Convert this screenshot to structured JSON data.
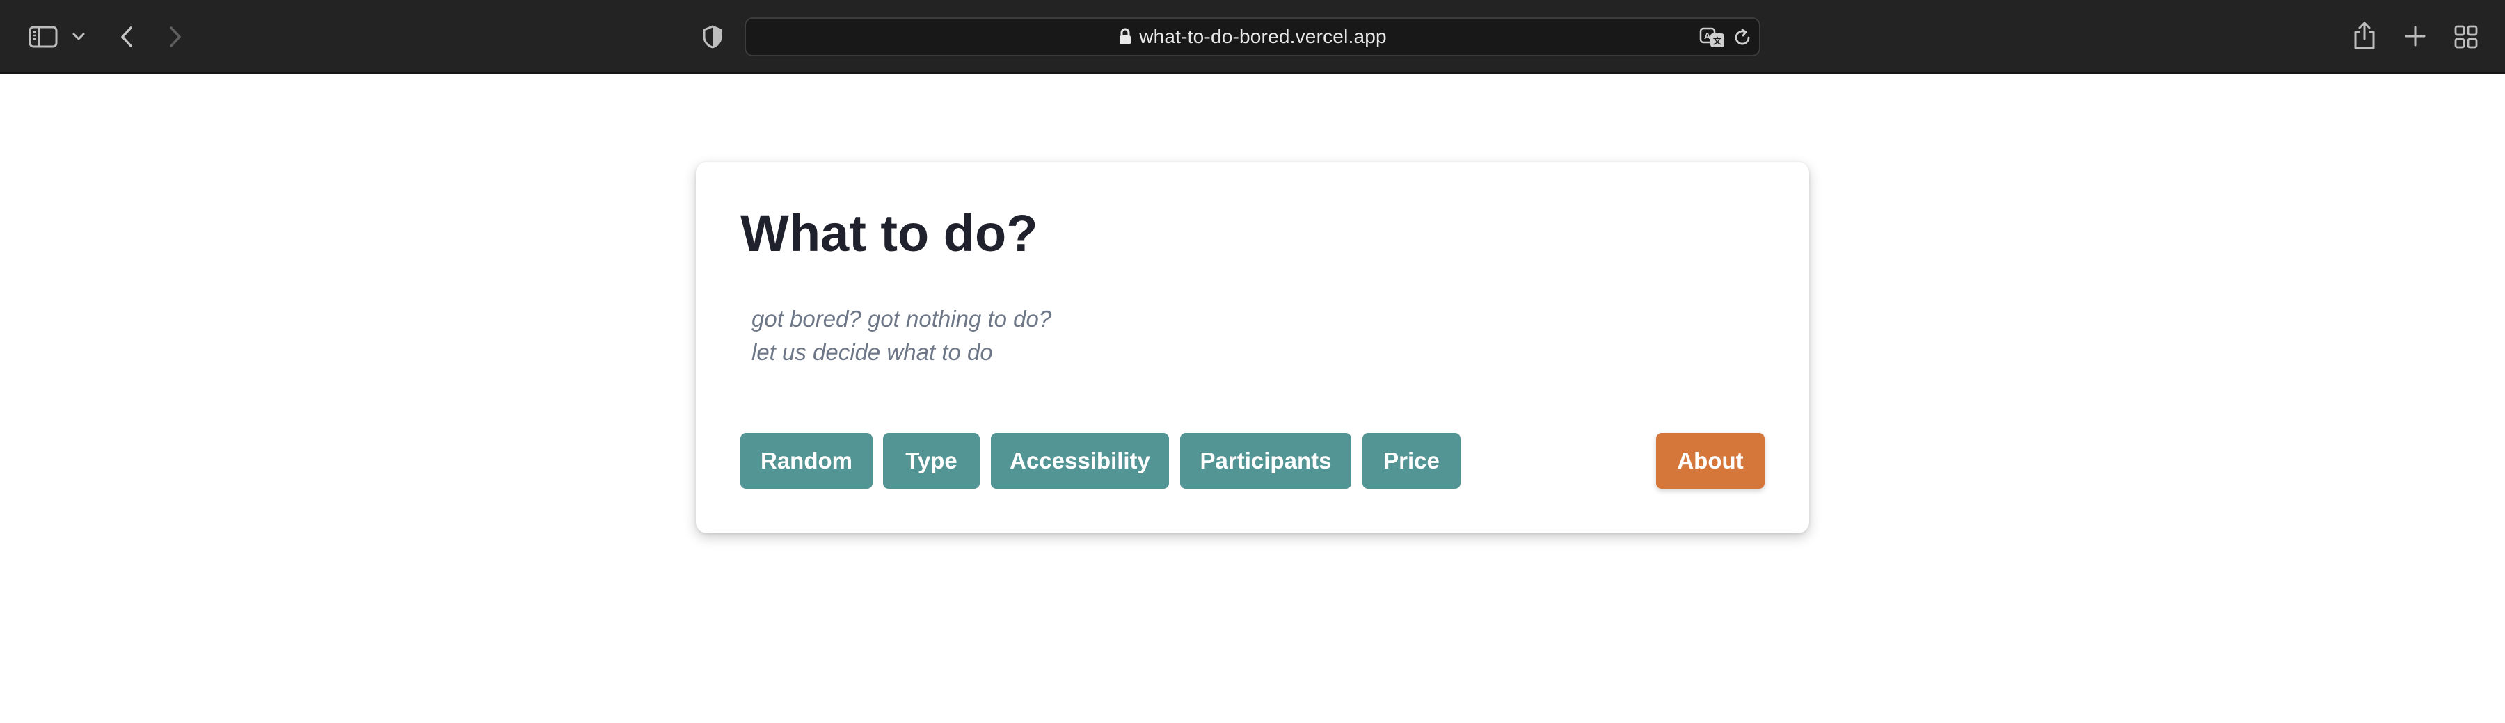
{
  "browser": {
    "url": "what-to-do-bored.vercel.app"
  },
  "app": {
    "title": "What to do?",
    "subtitle_line1": "got bored? got nothing to do?",
    "subtitle_line2": "let us decide what to do",
    "buttons": [
      {
        "label": "Random"
      },
      {
        "label": "Type"
      },
      {
        "label": "Accessibility"
      },
      {
        "label": "Participants"
      },
      {
        "label": "Price"
      }
    ],
    "about_label": "About"
  },
  "colors": {
    "primary_button": "#529594",
    "about_button": "#d5763a",
    "title": "#1f222d",
    "subtitle": "#6e7787",
    "toolbar": "#232323"
  }
}
